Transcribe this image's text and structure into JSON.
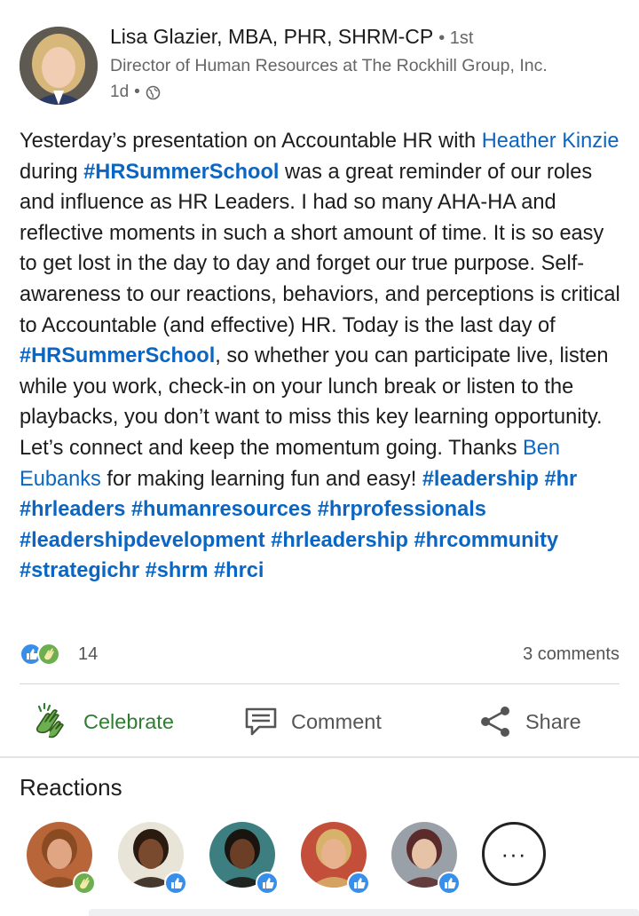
{
  "post": {
    "author": {
      "name": "Lisa Glazier, MBA, PHR, SHRM-CP",
      "degree": "• 1st",
      "headline": "Director of Human Resources at The Rockhill Group, Inc.",
      "time": "1d",
      "visibility_sep": "•",
      "visibility_icon": "globe-icon"
    },
    "body": {
      "s1": "Yesterday’s presentation on Accountable HR with ",
      "link_heather": "Heather Kinzie",
      "s2": " during ",
      "tag_summer1": "#HRSummerSchool",
      "s3": " was a great reminder of our roles and influence as HR Leaders. I had so many AHA-HA and reflective moments in such a short amount of time. It is so easy to get lost in the day to day and forget our true purpose.  Self-awareness to our reactions, behaviors, and perceptions is critical to Accountable (and effective) HR. Today is the last day of ",
      "tag_summer2": "#HRSummerSchool",
      "s4": ", so whether you can participate live, listen while you work, check-in on your lunch break or listen to the playbacks, you don’t want to miss this key learning opportunity.  Let’s connect and keep the momentum going. Thanks ",
      "link_ben": "Ben Eubanks",
      "s5": " for making learning fun and easy! ",
      "hashtags": [
        "#leadership",
        "#hr",
        "#hrleaders",
        "#humanresources",
        "#hrprofessionals",
        "#leadershipdevelopment",
        "#hrleadership",
        "#hrcommunity",
        "#strategichr",
        "#shrm",
        "#hrci"
      ]
    },
    "social": {
      "reaction_count": "14",
      "comments": "3 comments",
      "reaction_icons": [
        "like-icon",
        "celebrate-icon"
      ]
    },
    "actions": {
      "celebrate": "Celebrate",
      "comment": "Comment",
      "share": "Share"
    }
  },
  "reactions": {
    "title": "Reactions",
    "more_label": "···",
    "people": [
      {
        "badge": "celebrate",
        "colors": {
          "bg": "#b8653a",
          "face": "#e0a583",
          "hair": "#8a4b22"
        }
      },
      {
        "badge": "like",
        "colors": {
          "bg": "#e9e4d8",
          "face": "#7a4a2e",
          "hair": "#2a1a10"
        }
      },
      {
        "badge": "like",
        "colors": {
          "bg": "#3d7f80",
          "face": "#6b3e26",
          "hair": "#1a1410"
        }
      },
      {
        "badge": "like",
        "colors": {
          "bg": "#c34f3a",
          "face": "#e8b28f",
          "hair": "#d7b26b"
        }
      },
      {
        "badge": "like",
        "colors": {
          "bg": "#9aa0a8",
          "face": "#e6c3a6",
          "hair": "#5b2a2a"
        }
      }
    ]
  },
  "colors": {
    "link": "#0a66c2",
    "celebrate_green": "#2e7d32",
    "like_blue": "#378fe9"
  }
}
